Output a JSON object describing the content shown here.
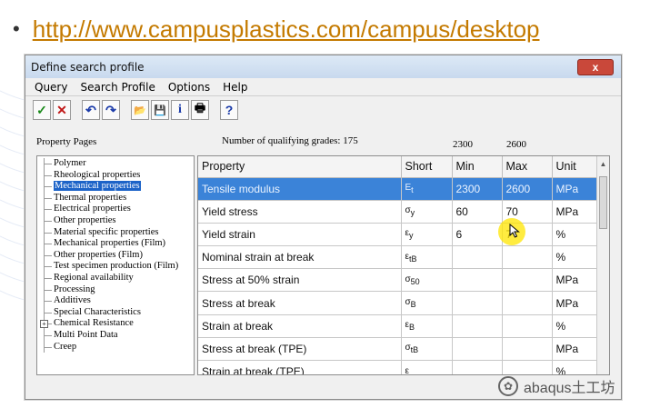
{
  "slide": {
    "bullet": "•",
    "link_text": "http://www.campusplastics.com/campus/desktop"
  },
  "window": {
    "title": "Define search profile",
    "close_label": "x",
    "menu": [
      "Query",
      "Search Profile",
      "Options",
      "Help"
    ],
    "toolbar_icons": [
      "check-icon",
      "cancel-icon",
      "undo-icon",
      "redo-icon",
      "open-folder-icon",
      "save-icon",
      "info-icon",
      "print-icon",
      "help-icon"
    ],
    "toolbar_glyphs": [
      "✓",
      "✕",
      "↶",
      "↷",
      "📂",
      "💾",
      "i",
      "🖶",
      "?"
    ],
    "property_pages_label": "Property Pages",
    "qualifying_label": "Number of qualifying grades:",
    "qualifying_count": "175",
    "min_top": "2300",
    "max_top": "2600"
  },
  "tree": {
    "selected_index": 2,
    "items": [
      "Polymer",
      "Rheological properties",
      "Mechanical properties",
      "Thermal properties",
      "Electrical properties",
      "Other properties",
      "Material specific properties",
      "Mechanical properties (Film)",
      "Other properties (Film)",
      "Test specimen production (Film)",
      "Regional availability",
      "Processing",
      "Additives",
      "Special Characteristics",
      "Chemical Resistance",
      "Multi Point Data",
      "Creep"
    ],
    "expandable_index": 14
  },
  "table": {
    "columns": [
      "Property",
      "Short",
      "Min",
      "Max",
      "Unit"
    ],
    "rows": [
      {
        "property": "Tensile modulus",
        "short": "E",
        "short_sub": "t",
        "min": "2300",
        "max": "2600",
        "unit": "MPa",
        "selected": true
      },
      {
        "property": "Yield stress",
        "short": "σ",
        "short_sub": "y",
        "min": "60",
        "max": "70",
        "unit": "MPa",
        "selected": false
      },
      {
        "property": "Yield strain",
        "short": "ε",
        "short_sub": "y",
        "min": "6",
        "max": "7",
        "unit": "%",
        "selected": false
      },
      {
        "property": "Nominal strain at break",
        "short": "ε",
        "short_sub": "tB",
        "min": "",
        "max": "",
        "unit": "%",
        "selected": false
      },
      {
        "property": "Stress at 50% strain",
        "short": "σ",
        "short_sub": "50",
        "min": "",
        "max": "",
        "unit": "MPa",
        "selected": false
      },
      {
        "property": "Stress at break",
        "short": "σ",
        "short_sub": "B",
        "min": "",
        "max": "",
        "unit": "MPa",
        "selected": false
      },
      {
        "property": "Strain at break",
        "short": "ε",
        "short_sub": "B",
        "min": "",
        "max": "",
        "unit": "%",
        "selected": false
      },
      {
        "property": "Stress at break (TPE)",
        "short": "σ",
        "short_sub": "tB",
        "min": "",
        "max": "",
        "unit": "MPa",
        "selected": false
      },
      {
        "property": "Strain at break (TPE)",
        "short": "ε",
        "short_sub": "",
        "min": "",
        "max": "",
        "unit": "%",
        "selected": false
      }
    ]
  },
  "watermark": {
    "text": "abaqus土工坊"
  },
  "colors": {
    "link": "#c47a00",
    "selection": "#3b83d8",
    "tree_selection": "#1c63c8"
  }
}
